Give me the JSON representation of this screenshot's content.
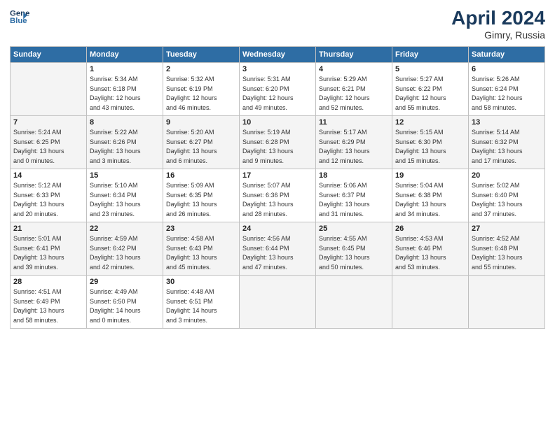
{
  "header": {
    "logo_line1": "General",
    "logo_line2": "Blue",
    "month": "April 2024",
    "location": "Gimry, Russia"
  },
  "weekdays": [
    "Sunday",
    "Monday",
    "Tuesday",
    "Wednesday",
    "Thursday",
    "Friday",
    "Saturday"
  ],
  "weeks": [
    [
      {
        "day": "",
        "info": ""
      },
      {
        "day": "1",
        "info": "Sunrise: 5:34 AM\nSunset: 6:18 PM\nDaylight: 12 hours\nand 43 minutes."
      },
      {
        "day": "2",
        "info": "Sunrise: 5:32 AM\nSunset: 6:19 PM\nDaylight: 12 hours\nand 46 minutes."
      },
      {
        "day": "3",
        "info": "Sunrise: 5:31 AM\nSunset: 6:20 PM\nDaylight: 12 hours\nand 49 minutes."
      },
      {
        "day": "4",
        "info": "Sunrise: 5:29 AM\nSunset: 6:21 PM\nDaylight: 12 hours\nand 52 minutes."
      },
      {
        "day": "5",
        "info": "Sunrise: 5:27 AM\nSunset: 6:22 PM\nDaylight: 12 hours\nand 55 minutes."
      },
      {
        "day": "6",
        "info": "Sunrise: 5:26 AM\nSunset: 6:24 PM\nDaylight: 12 hours\nand 58 minutes."
      }
    ],
    [
      {
        "day": "7",
        "info": "Sunrise: 5:24 AM\nSunset: 6:25 PM\nDaylight: 13 hours\nand 0 minutes."
      },
      {
        "day": "8",
        "info": "Sunrise: 5:22 AM\nSunset: 6:26 PM\nDaylight: 13 hours\nand 3 minutes."
      },
      {
        "day": "9",
        "info": "Sunrise: 5:20 AM\nSunset: 6:27 PM\nDaylight: 13 hours\nand 6 minutes."
      },
      {
        "day": "10",
        "info": "Sunrise: 5:19 AM\nSunset: 6:28 PM\nDaylight: 13 hours\nand 9 minutes."
      },
      {
        "day": "11",
        "info": "Sunrise: 5:17 AM\nSunset: 6:29 PM\nDaylight: 13 hours\nand 12 minutes."
      },
      {
        "day": "12",
        "info": "Sunrise: 5:15 AM\nSunset: 6:30 PM\nDaylight: 13 hours\nand 15 minutes."
      },
      {
        "day": "13",
        "info": "Sunrise: 5:14 AM\nSunset: 6:32 PM\nDaylight: 13 hours\nand 17 minutes."
      }
    ],
    [
      {
        "day": "14",
        "info": "Sunrise: 5:12 AM\nSunset: 6:33 PM\nDaylight: 13 hours\nand 20 minutes."
      },
      {
        "day": "15",
        "info": "Sunrise: 5:10 AM\nSunset: 6:34 PM\nDaylight: 13 hours\nand 23 minutes."
      },
      {
        "day": "16",
        "info": "Sunrise: 5:09 AM\nSunset: 6:35 PM\nDaylight: 13 hours\nand 26 minutes."
      },
      {
        "day": "17",
        "info": "Sunrise: 5:07 AM\nSunset: 6:36 PM\nDaylight: 13 hours\nand 28 minutes."
      },
      {
        "day": "18",
        "info": "Sunrise: 5:06 AM\nSunset: 6:37 PM\nDaylight: 13 hours\nand 31 minutes."
      },
      {
        "day": "19",
        "info": "Sunrise: 5:04 AM\nSunset: 6:38 PM\nDaylight: 13 hours\nand 34 minutes."
      },
      {
        "day": "20",
        "info": "Sunrise: 5:02 AM\nSunset: 6:40 PM\nDaylight: 13 hours\nand 37 minutes."
      }
    ],
    [
      {
        "day": "21",
        "info": "Sunrise: 5:01 AM\nSunset: 6:41 PM\nDaylight: 13 hours\nand 39 minutes."
      },
      {
        "day": "22",
        "info": "Sunrise: 4:59 AM\nSunset: 6:42 PM\nDaylight: 13 hours\nand 42 minutes."
      },
      {
        "day": "23",
        "info": "Sunrise: 4:58 AM\nSunset: 6:43 PM\nDaylight: 13 hours\nand 45 minutes."
      },
      {
        "day": "24",
        "info": "Sunrise: 4:56 AM\nSunset: 6:44 PM\nDaylight: 13 hours\nand 47 minutes."
      },
      {
        "day": "25",
        "info": "Sunrise: 4:55 AM\nSunset: 6:45 PM\nDaylight: 13 hours\nand 50 minutes."
      },
      {
        "day": "26",
        "info": "Sunrise: 4:53 AM\nSunset: 6:46 PM\nDaylight: 13 hours\nand 53 minutes."
      },
      {
        "day": "27",
        "info": "Sunrise: 4:52 AM\nSunset: 6:48 PM\nDaylight: 13 hours\nand 55 minutes."
      }
    ],
    [
      {
        "day": "28",
        "info": "Sunrise: 4:51 AM\nSunset: 6:49 PM\nDaylight: 13 hours\nand 58 minutes."
      },
      {
        "day": "29",
        "info": "Sunrise: 4:49 AM\nSunset: 6:50 PM\nDaylight: 14 hours\nand 0 minutes."
      },
      {
        "day": "30",
        "info": "Sunrise: 4:48 AM\nSunset: 6:51 PM\nDaylight: 14 hours\nand 3 minutes."
      },
      {
        "day": "",
        "info": ""
      },
      {
        "day": "",
        "info": ""
      },
      {
        "day": "",
        "info": ""
      },
      {
        "day": "",
        "info": ""
      }
    ]
  ]
}
